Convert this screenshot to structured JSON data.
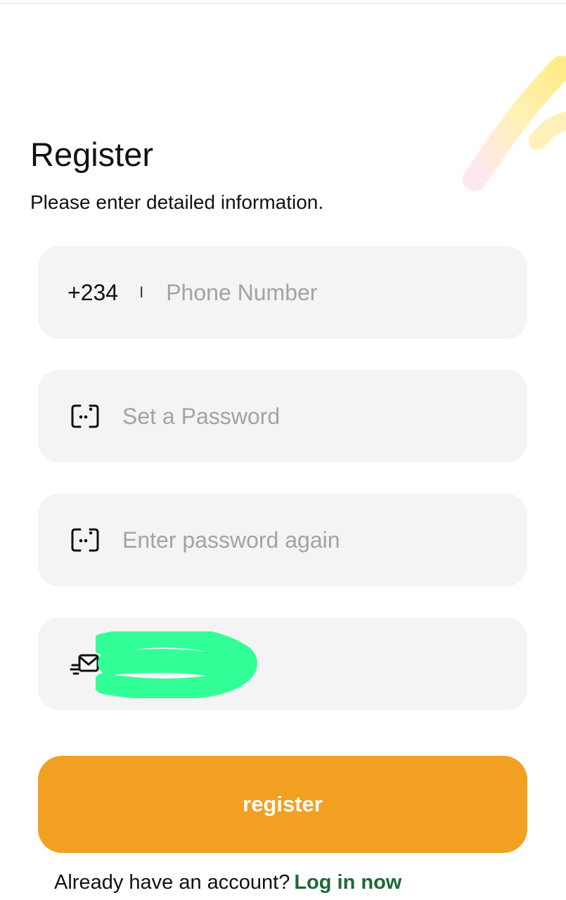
{
  "header": {
    "title": "Register",
    "subtitle": "Please enter detailed information."
  },
  "form": {
    "phone": {
      "country_code": "+234",
      "separator": "I",
      "placeholder": "Phone Number",
      "value": ""
    },
    "password": {
      "placeholder": "Set a Password",
      "value": "",
      "icon": "password-lock-icon"
    },
    "confirm_password": {
      "placeholder": "Enter password again",
      "value": "",
      "icon": "password-lock-icon"
    },
    "invite_code": {
      "icon": "invite-envelope-icon",
      "value": "",
      "redacted": true
    },
    "submit_label": "register"
  },
  "footer": {
    "prompt": "Already have an account?",
    "link_label": "Log in now"
  },
  "colors": {
    "accent": "#f1a022",
    "link": "#1c6a33",
    "field_bg": "#f4f4f4",
    "redaction": "#33ff99"
  }
}
